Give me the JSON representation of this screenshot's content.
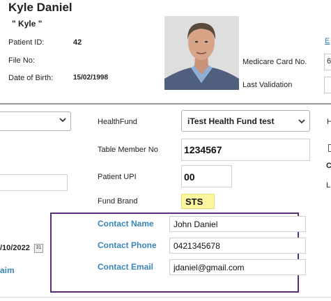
{
  "patient": {
    "name": "Kyle Daniel",
    "nickname": "\" Kyle \"",
    "id_label": "Patient ID:",
    "id_value": "42",
    "file_label": "File No:",
    "dob_label": "Date of Birth:",
    "dob_value": "15/02/1998"
  },
  "right_panel": {
    "edge_link": "E",
    "medicare_label": "Medicare Card No.",
    "medicare_value_partial": "6",
    "last_validation_label": "Last Validation"
  },
  "fund": {
    "healthfund_label": "HealthFund",
    "healthfund_value": "iTest Health Fund test",
    "table_member_label": "Table Member No",
    "table_member_value": "1234567",
    "upi_label": "Patient UPI",
    "upi_value": "00",
    "brand_label": "Fund Brand",
    "brand_value": "STS"
  },
  "contact": {
    "name_label": "Contact Name",
    "name_value": "John Daniel",
    "phone_label": "Contact Phone",
    "phone_value": "0421345678",
    "email_label": "Contact Email",
    "email_value": "jdaniel@gmail.com"
  },
  "left_partial": {
    "date_value": "/10/2022",
    "calendar_text": "31",
    "aim_text": "aim"
  },
  "right_edge": {
    "h_label": "H",
    "c_label": "C",
    "l_label": "L"
  },
  "icons": {
    "dropdown": "chevron-down-icon",
    "calendar": "calendar-icon"
  },
  "colors": {
    "label_blue": "#3a86b9",
    "highlight_yellow": "#f9f5a0",
    "box_purple": "#5a2d7a"
  }
}
